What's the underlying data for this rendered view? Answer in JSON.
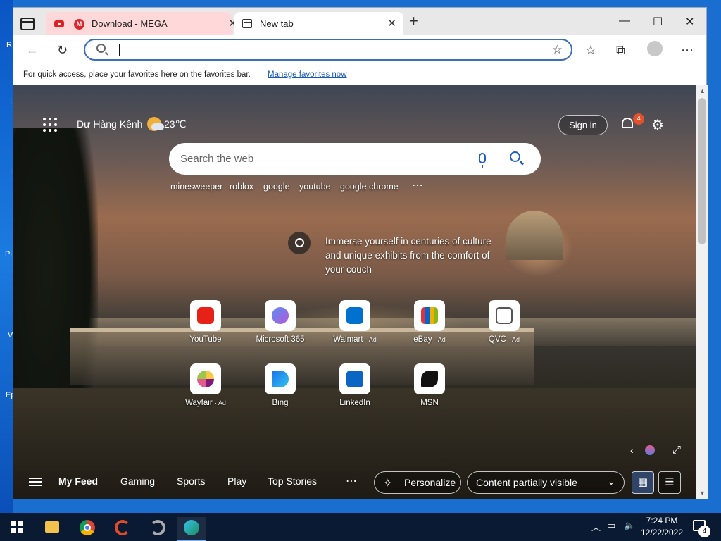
{
  "desktop": {
    "side_letters": [
      "R",
      "I",
      "I",
      "Pl",
      "V",
      "Ep"
    ]
  },
  "tabs": [
    {
      "title": "Download - MEGA",
      "close": "✕"
    },
    {
      "title": "New tab",
      "close": "✕"
    }
  ],
  "window_controls": {
    "minimize": "—",
    "maximize": "☐",
    "close": "✕"
  },
  "new_tab_button": "+",
  "toolbar": {
    "back": "←",
    "refresh": "↻",
    "favorites": "☆",
    "collections": "⧉",
    "menu": "⋯"
  },
  "favorites_bar": {
    "message": "For quick access, place your favorites here on the favorites bar.",
    "link": "Manage favorites now"
  },
  "ntp": {
    "location": "Dư Hàng Kênh",
    "temperature": "23℃",
    "sign_in": "Sign in",
    "notification_count": "4",
    "search_placeholder": "Search the web",
    "trending": [
      "minesweeper",
      "roblox",
      "google",
      "youtube",
      "google chrome"
    ],
    "more": "⋯",
    "immerse_text": "Immerse yourself in centuries of culture and unique exhibits from the comfort of your couch",
    "tiles": [
      {
        "label": "YouTube",
        "ad": "",
        "color": "#e62117"
      },
      {
        "label": "Microsoft 365",
        "ad": "",
        "color": "#7b5fe0"
      },
      {
        "label": "Walmart",
        "ad": "· Ad",
        "color": "#0071ce"
      },
      {
        "label": "eBay",
        "ad": "· Ad",
        "color": "#e53238"
      },
      {
        "label": "QVC",
        "ad": "· Ad",
        "color": "#555555"
      },
      {
        "label": "Wayfair",
        "ad": "· Ad",
        "color": "#7f187f"
      },
      {
        "label": "Bing",
        "ad": "",
        "color": "#1a73e8"
      },
      {
        "label": "LinkedIn",
        "ad": "",
        "color": "#0a66c2"
      },
      {
        "label": "MSN",
        "ad": "",
        "color": "#111111"
      }
    ],
    "feed_tabs": [
      "My Feed",
      "Gaming",
      "Sports",
      "Play",
      "Top Stories"
    ],
    "personalize": "Personalize",
    "content_visibility": "Content partially visible"
  },
  "taskbar": {
    "time": "7:24 PM",
    "date": "12/22/2022",
    "notification_count": "4",
    "apps": [
      "file-explorer",
      "chrome",
      "ccleaner",
      "settings-tool",
      "edge"
    ]
  }
}
